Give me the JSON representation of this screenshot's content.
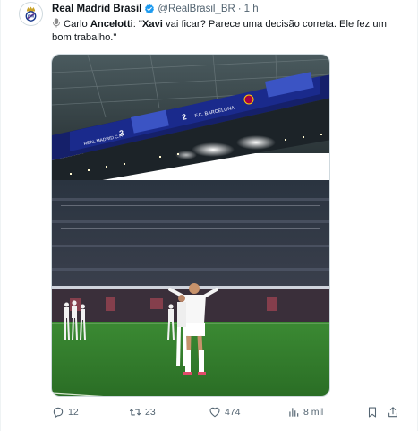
{
  "author": {
    "name": "Real Madrid Brasil",
    "handle": "@RealBrasil_BR",
    "separator": "·",
    "time": "1 h"
  },
  "tweet": {
    "part1": "Carlo ",
    "part2": "Ancelotti",
    "part3": ": \"",
    "part4": "Xavi",
    "part5": " vai ficar? Parece uma decisão correta. Ele fez um bom trabalho.\""
  },
  "scoreboard": {
    "home_team": "REAL MADRID C.F.",
    "home_score": "3",
    "away_score": "2",
    "away_team": "F.C. BARCELONA"
  },
  "actions": {
    "replies": "12",
    "retweets": "23",
    "likes": "474",
    "views": "8 mil"
  },
  "colors": {
    "verified": "#1d9bf0",
    "muted": "#536471",
    "pitch": "#2f7d2c",
    "board": "#1a2a8c"
  },
  "icons": [
    "crest-icon",
    "verified-icon",
    "microphone-icon",
    "reply-icon",
    "retweet-icon",
    "heart-icon",
    "views-icon",
    "bookmark-icon",
    "share-icon"
  ]
}
